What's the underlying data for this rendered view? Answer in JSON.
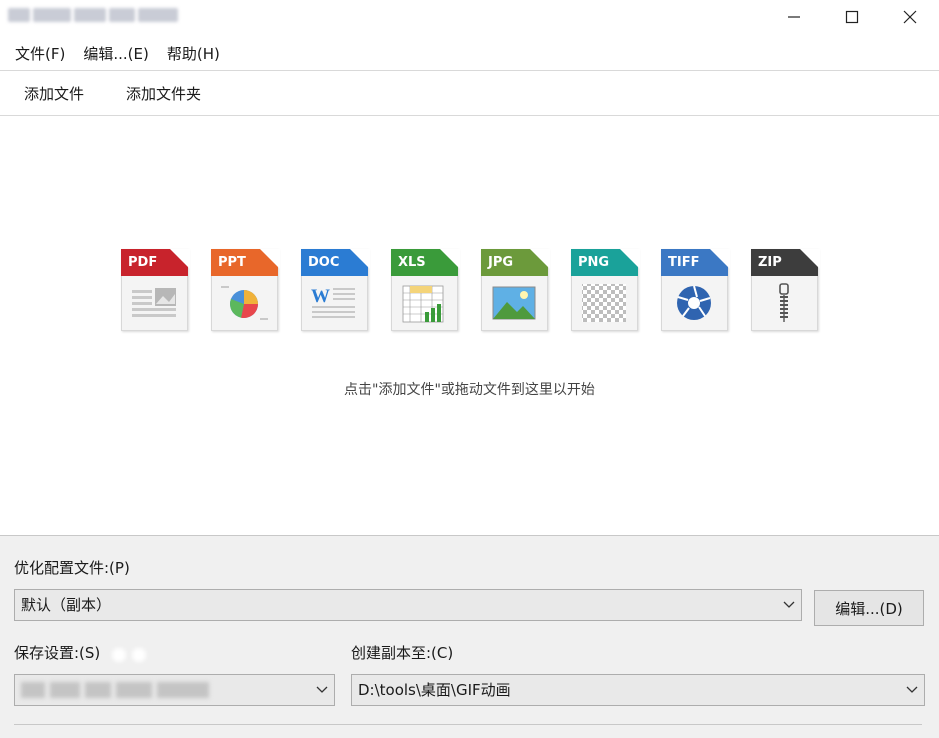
{
  "window": {
    "controls": [
      "minimize-icon",
      "maximize-icon",
      "close-icon"
    ]
  },
  "menu": {
    "file": "文件(F)",
    "edit": "编辑...(E)",
    "help": "帮助(H)"
  },
  "toolbar": {
    "add_file": "添加文件",
    "add_folder": "添加文件夹"
  },
  "dropzone": {
    "formats": [
      {
        "label": "PDF",
        "color": "#c8232c"
      },
      {
        "label": "PPT",
        "color": "#e8672a"
      },
      {
        "label": "DOC",
        "color": "#2b7cd3"
      },
      {
        "label": "XLS",
        "color": "#3a9b3a"
      },
      {
        "label": "JPG",
        "color": "#6c9a3b"
      },
      {
        "label": "PNG",
        "color": "#1aa29a"
      },
      {
        "label": "TIFF",
        "color": "#3b78c4"
      },
      {
        "label": "ZIP",
        "color": "#3d3d3d"
      }
    ],
    "hint": "点击\"添加文件\"或拖动文件到这里以开始"
  },
  "settings": {
    "profile_label": "优化配置文件:(P)",
    "profile_value": "默认（副本）",
    "edit_button": "编辑...(D)",
    "save_label": "保存设置:(S)",
    "copy_label": "创建副本至:(C)",
    "copy_value": "D:\\tools\\桌面\\GIF动画"
  }
}
